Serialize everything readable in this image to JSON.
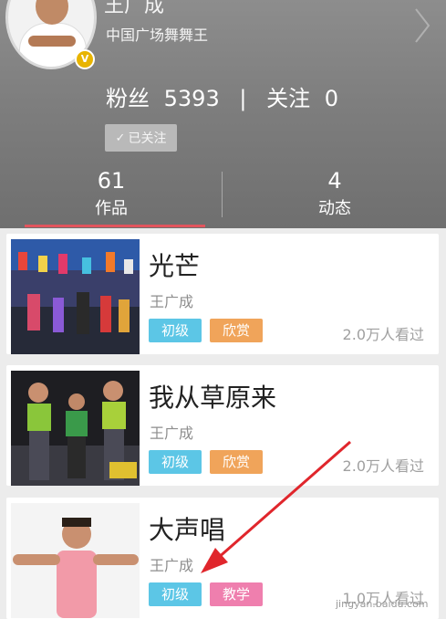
{
  "profile": {
    "name": "王广成",
    "subtitle": "中国广场舞舞王",
    "fans_label": "粉丝",
    "fans_count": "5393",
    "separator": "|",
    "following_label": "关注",
    "following_count": "0",
    "follow_button": "已关注"
  },
  "tabs": [
    {
      "count": "61",
      "label": "作品",
      "active": true
    },
    {
      "count": "4",
      "label": "动态",
      "active": false
    }
  ],
  "videos": [
    {
      "title": "光芒",
      "author": "王广成",
      "tags": [
        "初级",
        "欣赏"
      ],
      "views": "2.0万人看过"
    },
    {
      "title": "我从草原来",
      "author": "王广成",
      "tags": [
        "初级",
        "欣赏"
      ],
      "views": "2.0万人看过"
    },
    {
      "title": "大声唱",
      "author": "王广成",
      "tags": [
        "初级",
        "教学"
      ],
      "views": "1.0万人看过"
    }
  ],
  "colors": {
    "tag_level": "#5cc6e6",
    "tag_appreciate": "#f0a45a",
    "tag_teach": "#ef7fae",
    "tab_indicator": "#e2555d",
    "arrow": "#e0262c"
  },
  "watermark": "jingyan.baidu.com"
}
